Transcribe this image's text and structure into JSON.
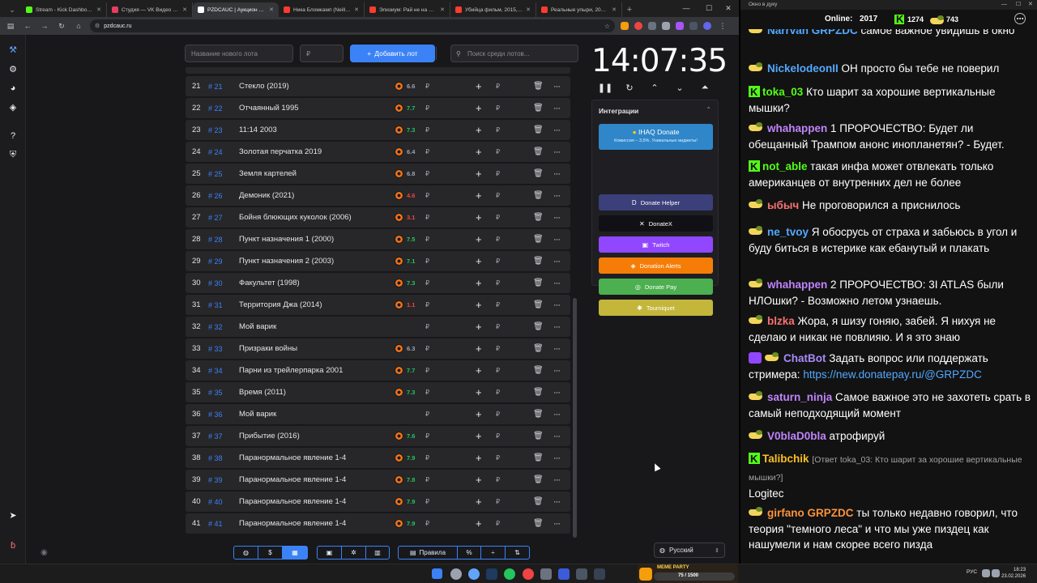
{
  "browser": {
    "tabs": [
      {
        "title": "Stream - Kick Dashboard",
        "color": "#53fc18"
      },
      {
        "title": "Студия — VK Видео Live",
        "color": "#e53e5f"
      },
      {
        "title": "PZDCAUC | Аукцион для ст",
        "color": "#ffffff",
        "active": true
      },
      {
        "title": "Ника Бломкамп (Neill Blomk",
        "color": "#ff3b30"
      },
      {
        "title": "Элизиум: Рай не на Земле",
        "color": "#ff3b30"
      },
      {
        "title": "Убийца фильм, 2015, дата",
        "color": "#ff3b30"
      },
      {
        "title": "Реальные упыри, 2014 — о",
        "color": "#ff3b30"
      }
    ],
    "address": "pzdcauc.ru"
  },
  "lot_form": {
    "name_placeholder": "Название нового лота",
    "amount_placeholder": "₽",
    "add_label": "Добавить лот",
    "search_placeholder": "Поиск среди лотов..."
  },
  "lots": [
    {
      "num": "21",
      "id": "# 21",
      "title": "Стекло (2019)",
      "rating": "6.6",
      "rating_color": "#9ca3af",
      "kp": true
    },
    {
      "num": "22",
      "id": "# 22",
      "title": "Отчаянный 1995",
      "rating": "7.7",
      "rating_color": "#22c55e",
      "kp": true
    },
    {
      "num": "23",
      "id": "# 23",
      "title": "11:14 2003",
      "rating": "7.3",
      "rating_color": "#22c55e",
      "kp": true
    },
    {
      "num": "24",
      "id": "# 24",
      "title": "Золотая перчатка 2019",
      "rating": "6.4",
      "rating_color": "#9ca3af",
      "kp": true
    },
    {
      "num": "25",
      "id": "# 25",
      "title": "Земля картелей",
      "rating": "6.8",
      "rating_color": "#9ca3af",
      "kp": true
    },
    {
      "num": "26",
      "id": "# 26",
      "title": "Демоник (2021)",
      "rating": "4.6",
      "rating_color": "#ef4444",
      "kp": true
    },
    {
      "num": "27",
      "id": "# 27",
      "title": "Бойня блюющих куколок (2006)",
      "rating": "3.1",
      "rating_color": "#ef4444",
      "kp": true
    },
    {
      "num": "28",
      "id": "# 28",
      "title": "Пункт назначения 1 (2000)",
      "rating": "7.5",
      "rating_color": "#22c55e",
      "kp": true
    },
    {
      "num": "29",
      "id": "# 29",
      "title": "Пункт назначения 2 (2003)",
      "rating": "7.1",
      "rating_color": "#22c55e",
      "kp": true
    },
    {
      "num": "30",
      "id": "# 30",
      "title": "Факультет (1998)",
      "rating": "7.3",
      "rating_color": "#22c55e",
      "kp": true
    },
    {
      "num": "31",
      "id": "# 31",
      "title": "Территория Джа (2014)",
      "rating": "1.1",
      "rating_color": "#ef4444",
      "kp": true
    },
    {
      "num": "32",
      "id": "# 32",
      "title": "Мой варик",
      "rating": "",
      "rating_color": "#9ca3af",
      "kp": false
    },
    {
      "num": "33",
      "id": "# 33",
      "title": "Призраки войны",
      "rating": "6.3",
      "rating_color": "#9ca3af",
      "kp": true
    },
    {
      "num": "34",
      "id": "# 34",
      "title": "Парни из трейлерпарка 2001",
      "rating": "7.7",
      "rating_color": "#22c55e",
      "kp": true
    },
    {
      "num": "35",
      "id": "# 35",
      "title": "Время (2011)",
      "rating": "7.3",
      "rating_color": "#22c55e",
      "kp": true
    },
    {
      "num": "36",
      "id": "# 36",
      "title": "Мой варик",
      "rating": "",
      "rating_color": "#9ca3af",
      "kp": false
    },
    {
      "num": "37",
      "id": "# 37",
      "title": "Прибытие (2016)",
      "rating": "7.6",
      "rating_color": "#22c55e",
      "kp": true
    },
    {
      "num": "38",
      "id": "# 38",
      "title": "Паранормальное явление 1-4",
      "rating": "7.9",
      "rating_color": "#22c55e",
      "kp": true
    },
    {
      "num": "39",
      "id": "# 39",
      "title": "Паранормальное явление 1-4",
      "rating": "7.8",
      "rating_color": "#22c55e",
      "kp": true
    },
    {
      "num": "40",
      "id": "# 40",
      "title": "Паранормальное явление 1-4",
      "rating": "7.9",
      "rating_color": "#22c55e",
      "kp": true
    },
    {
      "num": "41",
      "id": "# 41",
      "title": "Паранормальное явление 1-4",
      "rating": "7.9",
      "rating_color": "#22c55e",
      "kp": true
    }
  ],
  "lot_currency": "₽",
  "timer": "14:07:35",
  "integrations": {
    "title": "Интеграции",
    "ihaq_title": "IHAQ Donate",
    "ihaq_sub": "Комиссия – 3,5%. Уникальные виджеты!",
    "buttons": [
      {
        "label": "Donate Helper",
        "color": "#3b3f7a",
        "icon": "D"
      },
      {
        "label": "DonateX",
        "color": "#111115",
        "icon": "✕"
      },
      {
        "label": "Twitch",
        "color": "#9147ff",
        "icon": "▣"
      },
      {
        "label": "Donation Alerts",
        "color": "#f57d07",
        "icon": "◈"
      },
      {
        "label": "Donate Pay",
        "color": "#4caf50",
        "icon": "◎"
      },
      {
        "label": "Tourniquet",
        "color": "#c3b63a",
        "icon": "✱"
      }
    ]
  },
  "bottom": {
    "rules_label": "Правила",
    "language": "Русский"
  },
  "chat": {
    "window_title": "Окно в дуку",
    "online_label": "Online:",
    "online": "2017",
    "kick_count": "1274",
    "other_count": "743",
    "messages": [
      {
        "badge": "d",
        "user": "Narrvan GRPZDC",
        "color": "#53a8ff",
        "text": "самое важное увидишь в окно"
      },
      {
        "badge": "d",
        "user": "NickelodeonII",
        "color": "#53a8ff",
        "text": "ОН просто бы тебе не поверил"
      },
      {
        "badge": "k",
        "user": "toka_03",
        "color": "#53fc18",
        "text": "Кто шарит за хорошие вертикальные мышки?"
      },
      {
        "badge": "d",
        "user": "whahappen",
        "color": "#c084fc",
        "text": "1 ПРОРОЧЕСТВО: Будет ли обещанный Трампом анонс инопланетян? - Будет."
      },
      {
        "badge": "k",
        "user": "not_able",
        "color": "#53fc18",
        "text": "такая инфа может отвлекать только американцев от внутренних дел не более"
      },
      {
        "badge": "d",
        "user": "ыбыч",
        "color": "#f87171",
        "text": "Не проговорился а приснилось"
      },
      {
        "badge": "d",
        "user": "ne_tvoy",
        "color": "#53a8ff",
        "text": "Я обосрусь от страха и забьюсь в угол и буду биться в истерике как ебанутый и плакать"
      },
      {
        "badge": "d",
        "user": "whahappen",
        "color": "#c084fc",
        "text": "2 ПРОРОЧЕСТВО: 3I ATLAS были НЛОшки? - Возможно летом узнаешь."
      },
      {
        "badge": "d",
        "user": "blzka",
        "color": "#f87171",
        "text": "Жора, я шизу гоняю, забей. Я нихуя не сделаю и никак не повлияю. И я это знаю"
      },
      {
        "badge": "bot",
        "user": "ChatBot",
        "color": "#a78bfa",
        "text": "Задать вопрос или поддержать стримера:",
        "link": "https://new.donatepay.ru/@GRPZDC"
      },
      {
        "badge": "d",
        "user": "saturn_ninja",
        "color": "#c084fc",
        "text": "Самое важное это не захотеть срать в самый неподходящий момент"
      },
      {
        "badge": "d",
        "user": "V0blaD0bla",
        "color": "#c084fc",
        "text": "атрофируй"
      },
      {
        "badge": "k",
        "user": "Talibchik",
        "color": "#fbbf24",
        "reply": "[Ответ toka_03: Кто шарит за хорошие вертикальные мышки?]",
        "text": "Logitec"
      },
      {
        "badge": "d",
        "user": "girfano GRPZDC",
        "color": "#fb923c",
        "text": "ты только недавно говорил, что теория \"темного леса\" и что мы уже пиздец как нашумели и нам скорее всего пизда"
      }
    ]
  },
  "taskbar": {
    "meme_label": "MEME PARTY",
    "meme_value": "75 / 1500",
    "lang": "РУС",
    "time": "18:23",
    "date": "23.02.2026"
  }
}
